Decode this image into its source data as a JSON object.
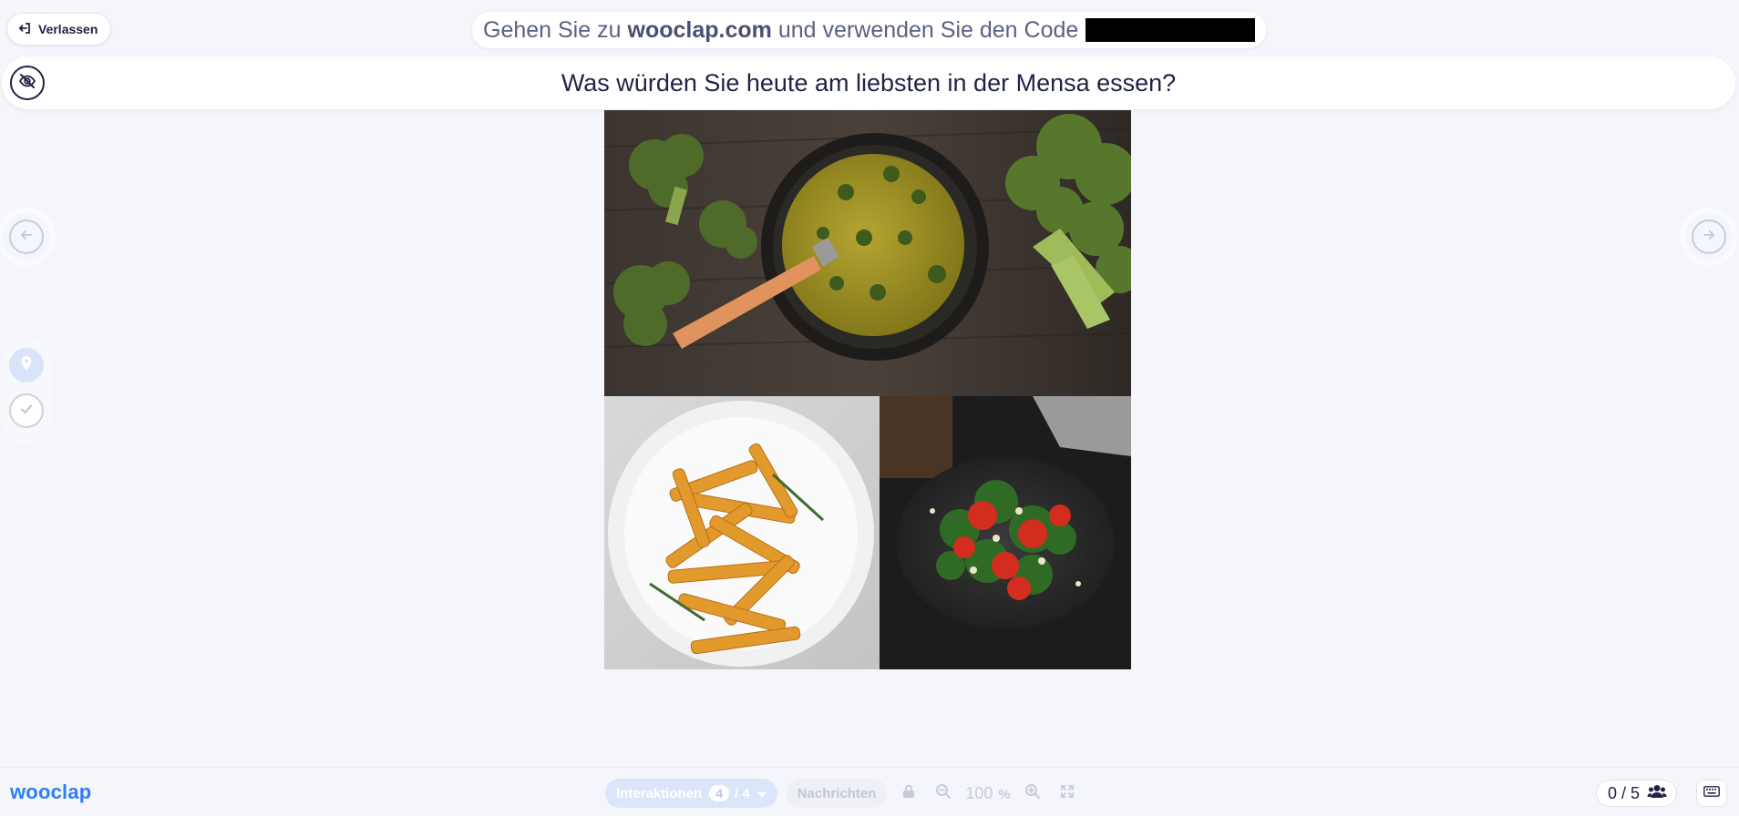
{
  "header": {
    "leave_label": "Verlassen",
    "join_prefix": "Gehen Sie zu",
    "join_site": "wooclap.com",
    "join_suffix": "und verwenden Sie den Code"
  },
  "question": {
    "text": "Was würden Sie heute am liebsten in der Mensa essen?"
  },
  "images": [
    {
      "name": "broccoli-soup-image"
    },
    {
      "name": "french-fries-image"
    },
    {
      "name": "tomato-salad-image"
    }
  ],
  "footer": {
    "logo": "wooclap",
    "interactions_label": "Interaktionen",
    "interactions_current": "4",
    "interactions_total": "/ 4",
    "messages_label": "Nachrichten",
    "zoom_value": "100",
    "zoom_unit": "%",
    "participants": "0 / 5"
  },
  "colors": {
    "accent": "#2f7df6",
    "background": "#f4f6fb",
    "text": "#1f2345"
  }
}
